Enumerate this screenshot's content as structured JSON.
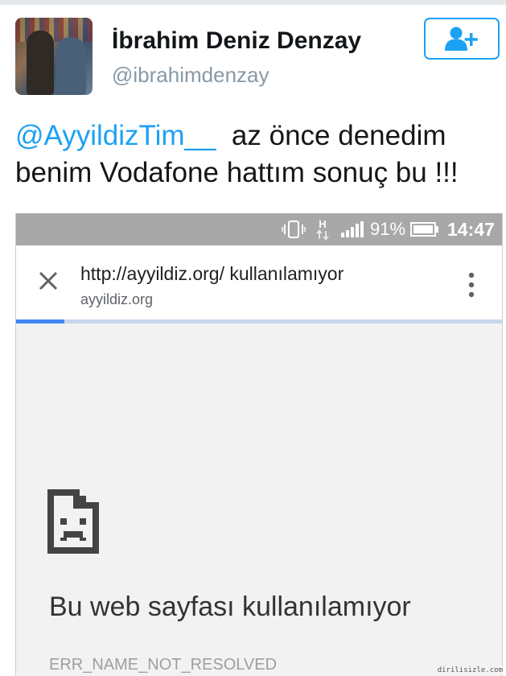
{
  "tweet": {
    "display_name": "İbrahim Deniz Denzay",
    "handle": "@ibrahimdenzay",
    "mention": "@AyyildizTim__",
    "text_line1_rest": "  az önce denedim",
    "text_line2": "benim Vodafone hattım sonuç bu !!!",
    "follow_icon": "add-user-icon",
    "accent_color": "#1da1f2"
  },
  "phone": {
    "status": {
      "battery_percent": "91%",
      "time": "14:47",
      "network_label": "H",
      "icons": [
        "vibrate-icon",
        "network-h-icon",
        "signal-icon",
        "battery-icon"
      ]
    },
    "browser": {
      "page_title": "http://ayyildiz.org/ kullanılamıyor",
      "domain": "ayyildiz.org",
      "load_progress": 0.1
    },
    "error": {
      "icon": "sad-page-icon",
      "title": "Bu web sayfası kullanılamıyor",
      "code": "ERR_NAME_NOT_RESOLVED"
    }
  },
  "watermark": "dirilisizle.com"
}
